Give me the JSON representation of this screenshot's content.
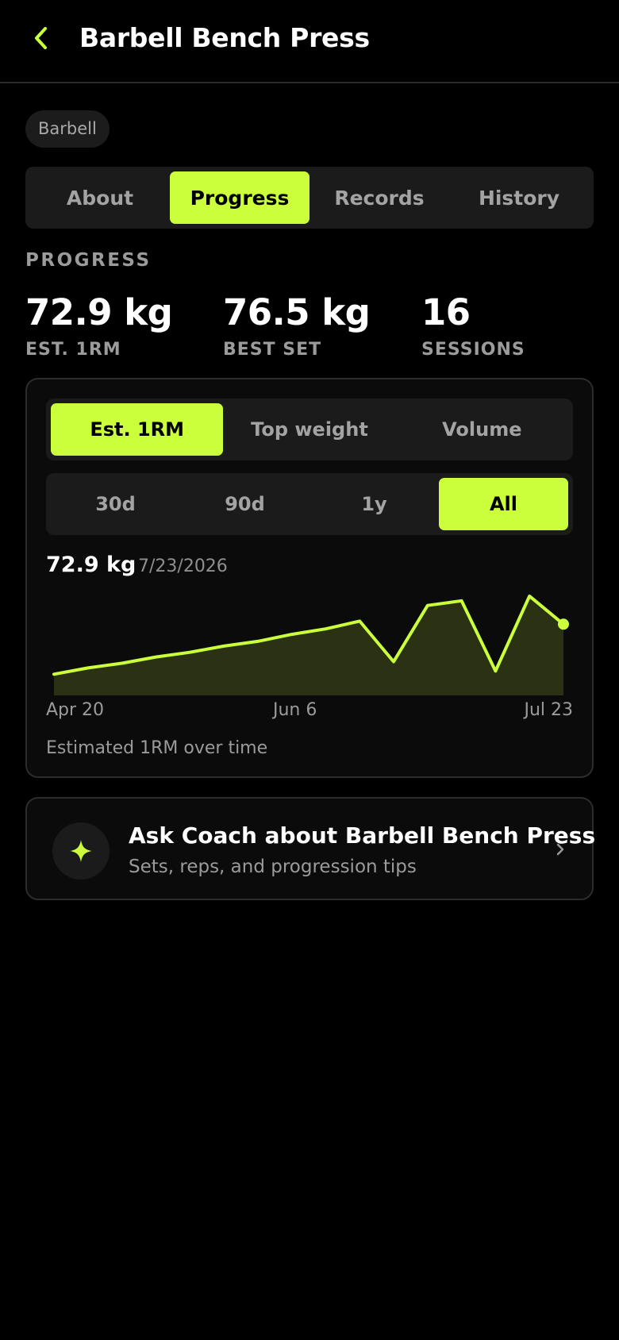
{
  "header": {
    "title": "Barbell Bench Press",
    "back_icon": "chevron-left-icon"
  },
  "chip": "Barbell",
  "tabs": [
    {
      "label": "About",
      "active": false
    },
    {
      "label": "Progress",
      "active": true
    },
    {
      "label": "Records",
      "active": false
    },
    {
      "label": "History",
      "active": false
    }
  ],
  "progress": {
    "section_label": "PROGRESS",
    "stats": [
      {
        "value": "72.9 kg",
        "label": "EST. 1RM"
      },
      {
        "value": "76.5 kg",
        "label": "BEST SET"
      },
      {
        "value": "16",
        "label": "SESSIONS"
      }
    ]
  },
  "metric_options": [
    {
      "label": "Est. 1RM",
      "active": true
    },
    {
      "label": "Top weight",
      "active": false
    },
    {
      "label": "Volume",
      "active": false
    }
  ],
  "range_options": [
    {
      "label": "30d",
      "active": false
    },
    {
      "label": "90d",
      "active": false
    },
    {
      "label": "1y",
      "active": false
    },
    {
      "label": "All",
      "active": true
    }
  ],
  "chart": {
    "current_value": "72.9 kg",
    "current_date": "7/23/2026",
    "x_ticks": [
      "Apr 20",
      "Jun 6",
      "Jul 23"
    ],
    "caption": "Estimated 1RM over time"
  },
  "chart_data": {
    "type": "area",
    "series": [
      {
        "values": [
          66.5,
          67.3,
          67.9,
          68.7,
          69.3,
          70.1,
          70.7,
          71.6,
          72.3,
          73.3,
          68.1,
          75.3,
          75.9,
          66.9,
          76.5,
          72.9
        ]
      }
    ],
    "color": "#cbff3c"
  },
  "coach": {
    "title": "Ask Coach about Barbell Bench Press",
    "subtitle": "Sets, reps, and progression tips",
    "icon": "sparkle-icon",
    "chevron_icon": "chevron-right-icon"
  },
  "colors": {
    "accent": "#cbff3c",
    "background": "#000000",
    "card": "#0b0b0b"
  }
}
